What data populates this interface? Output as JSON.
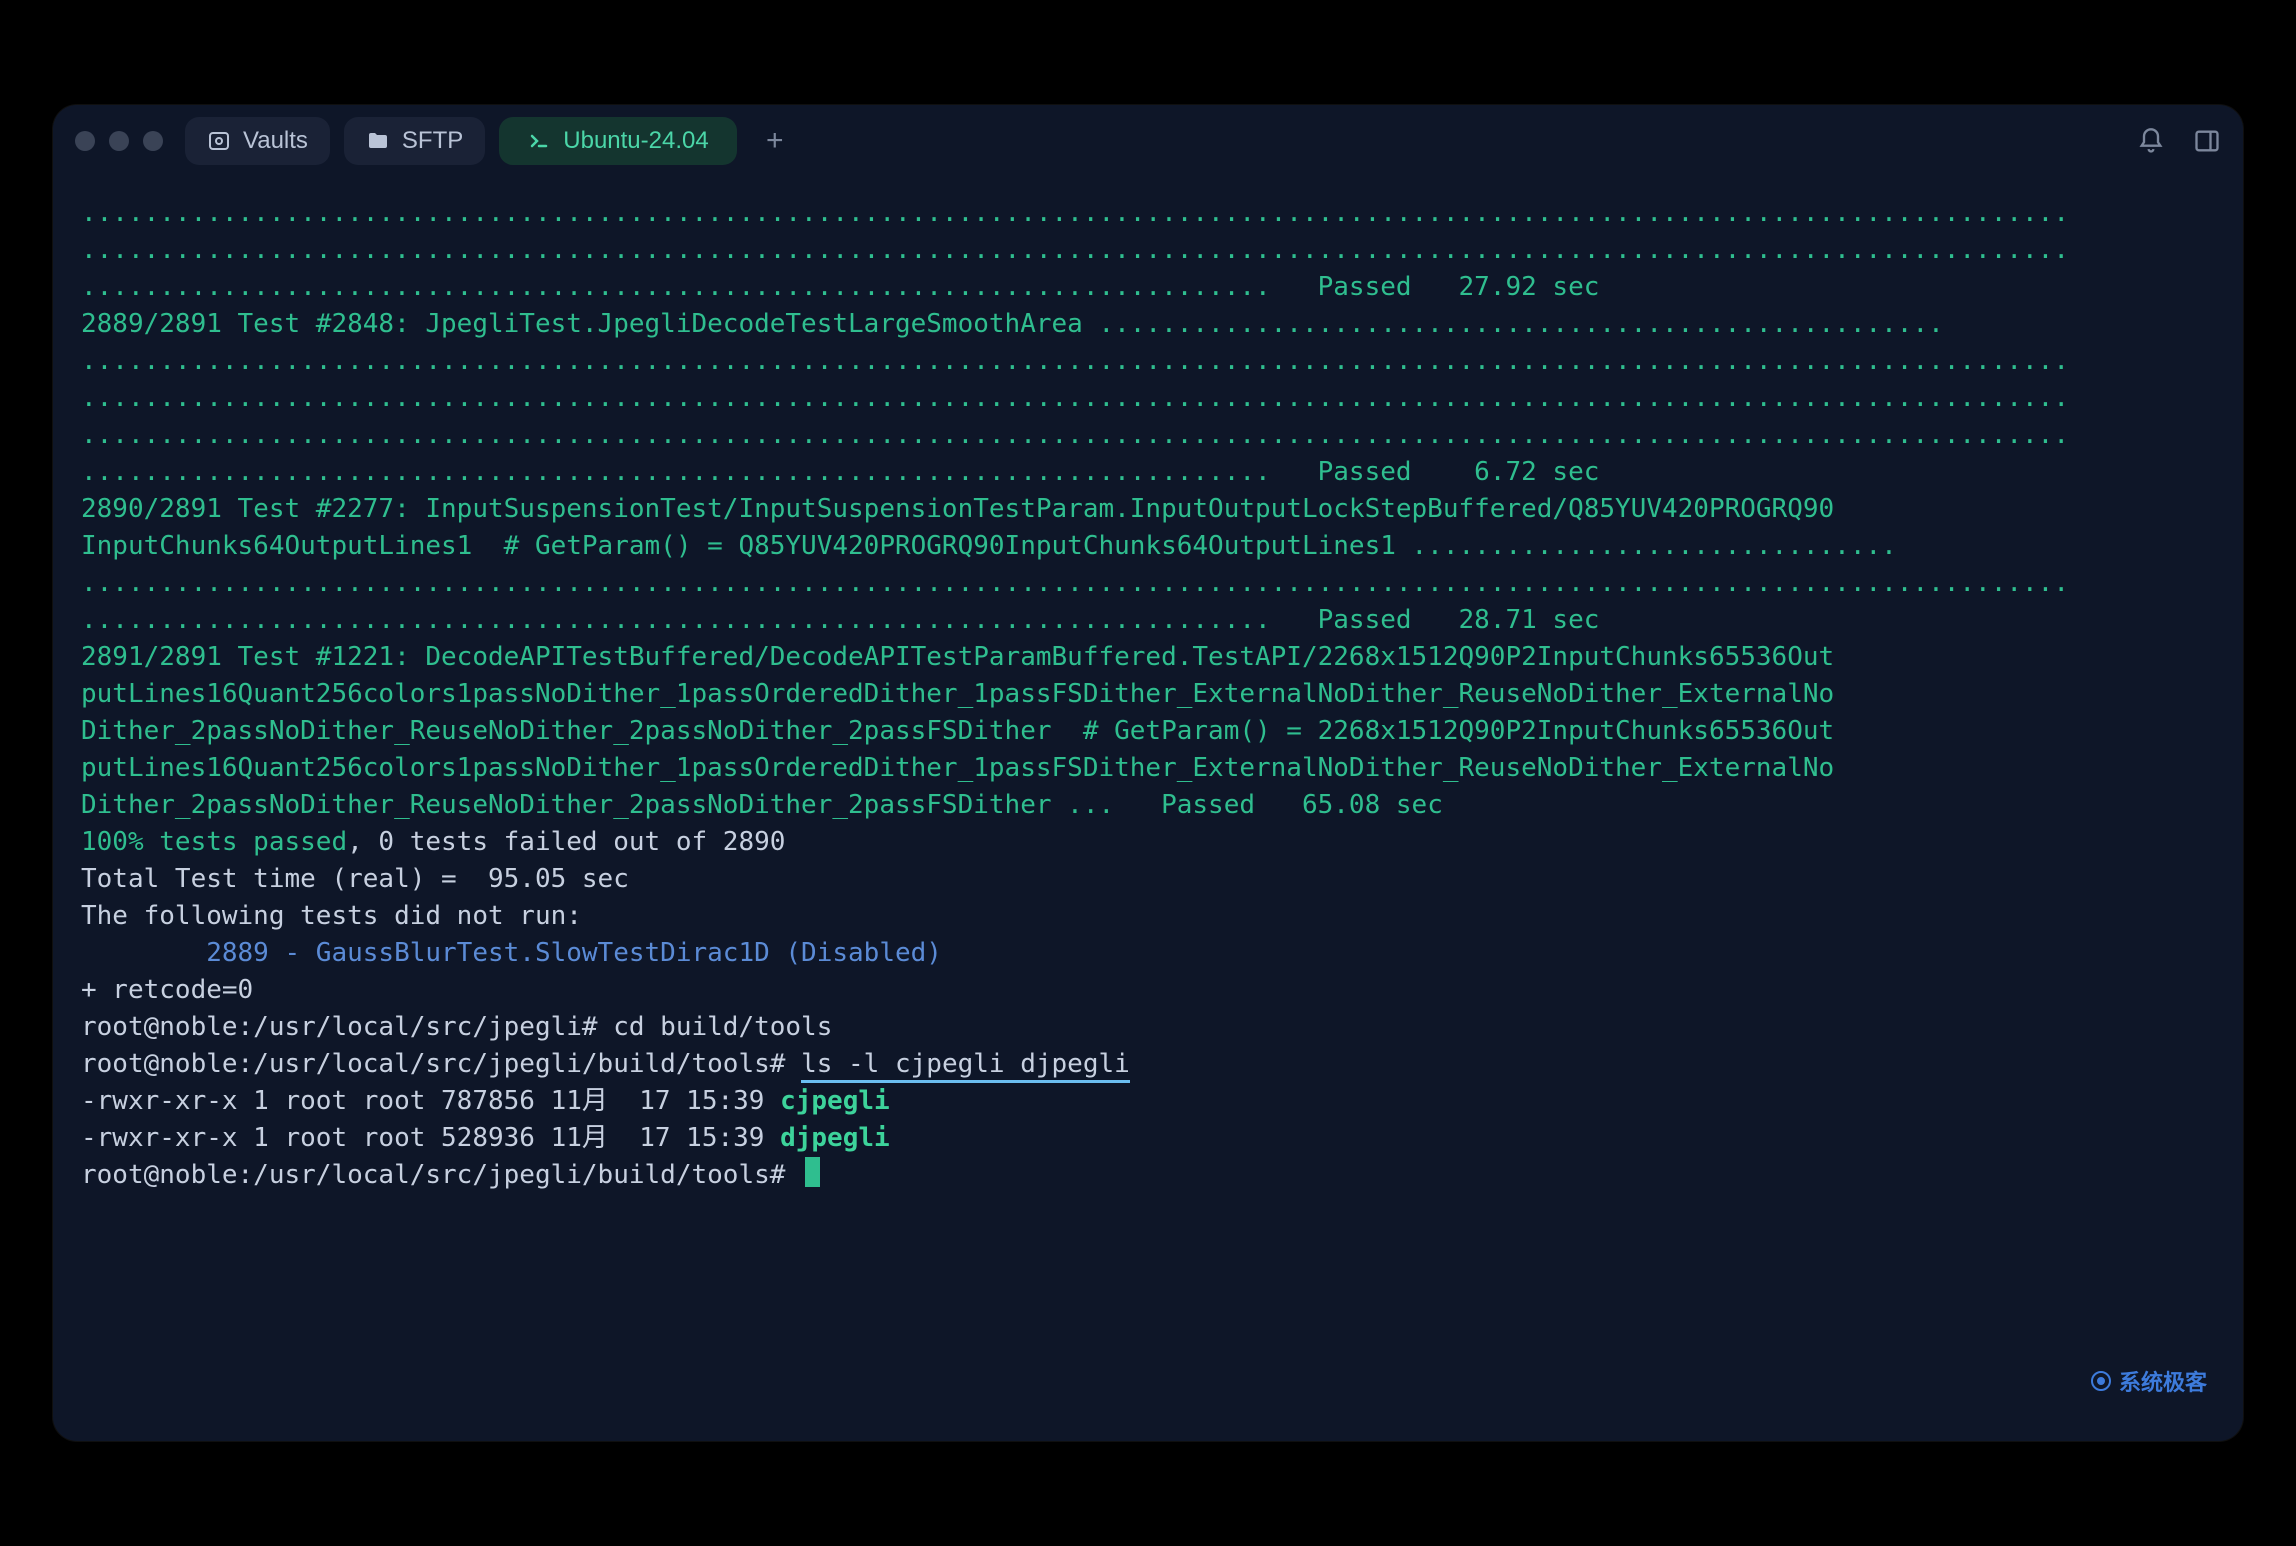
{
  "tabs": {
    "vaults": "Vaults",
    "sftp": "SFTP",
    "ubuntu": "Ubuntu-24.04"
  },
  "dots_row1": "...............................................................................................................................",
  "dots_row2": "...............................................................................................................................",
  "dots_row3": "............................................................................   ",
  "pass1": "Passed   27.92 sec",
  "test1": "2889/2891 Test #2848: JpegliTest.JpegliDecodeTestLargeSmoothArea ......................................................",
  "dots_row4": "...............................................................................................................................",
  "dots_row5": "...............................................................................................................................",
  "dots_row6": "...............................................................................................................................",
  "dots_row7": "............................................................................   ",
  "pass2": "Passed    6.72 sec",
  "test2a": "2890/2891 Test #2277: InputSuspensionTest/InputSuspensionTestParam.InputOutputLockStepBuffered/Q85YUV420PROGRQ90",
  "test2b": "InputChunks64OutputLines1  # GetParam() = Q85YUV420PROGRQ90InputChunks64OutputLines1 ...............................",
  "dots_row8": "...............................................................................................................................",
  "dots_row9": "............................................................................   ",
  "pass3": "Passed   28.71 sec",
  "test3a": "2891/2891 Test #1221: DecodeAPITestBuffered/DecodeAPITestParamBuffered.TestAPI/2268x1512Q90P2InputChunks65536Out",
  "test3b": "putLines16Quant256colors1passNoDither_1passOrderedDither_1passFSDither_ExternalNoDither_ReuseNoDither_ExternalNo",
  "test3c": "Dither_2passNoDither_ReuseNoDither_2passNoDither_2passFSDither  # GetParam() = 2268x1512Q90P2InputChunks65536Out",
  "test3d": "putLines16Quant256colors1passNoDither_1passOrderedDither_1passFSDither_ExternalNoDither_ReuseNoDither_ExternalNo",
  "test3e": "Dither_2passNoDither_ReuseNoDither_2passNoDither_2passFSDither ...   ",
  "pass4": "Passed   65.08 sec",
  "blank": "",
  "summary_pass": "100% tests passed",
  "summary_rest": ", 0 tests failed out of 2890",
  "total_time": "Total Test time (real) =  95.05 sec",
  "not_run_hdr": "The following tests did not run:",
  "not_run_item": "        2889 - GaussBlurTest.SlowTestDirac1D (Disabled)",
  "retcode": "+ retcode=0",
  "prompt1_pre": "root@noble:/usr/local/src/jpegli# ",
  "prompt1_cmd": "cd build/tools",
  "prompt2_pre": "root@noble:/usr/local/src/jpegli/build/tools# ",
  "prompt2_cmd": "ls -l cjpegli djpegli",
  "ls1_pre": "-rwxr-xr-x 1 root root 787856 11月  17 15:39 ",
  "ls1_file": "cjpegli",
  "ls2_pre": "-rwxr-xr-x 1 root root 528936 11月  17 15:39 ",
  "ls2_file": "djpegli",
  "prompt3": "root@noble:/usr/local/src/jpegli/build/tools# ",
  "watermark": "系统极客"
}
